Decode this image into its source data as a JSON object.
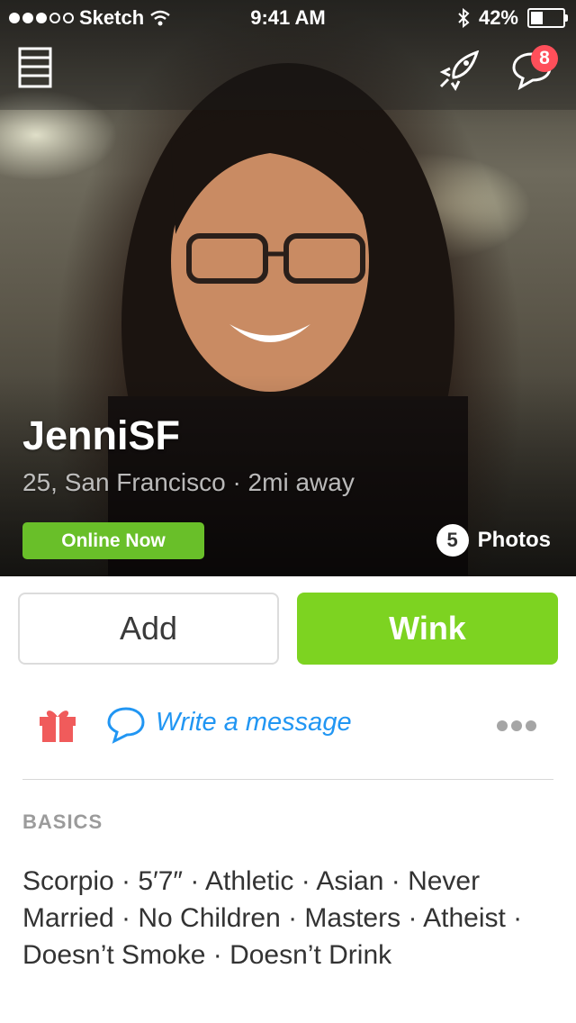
{
  "status_bar": {
    "carrier": "Sketch",
    "time": "9:41 AM",
    "battery_percent": "42%",
    "battery_level": 0.42
  },
  "nav": {
    "menu_icon": "menu-icon",
    "boost_icon": "rocket-icon",
    "messages_icon": "chat-bubble-icon",
    "messages_badge": "8"
  },
  "profile": {
    "name": "JenniSF",
    "subline": "25, San Francisco · 2mi away",
    "status": "Online Now",
    "photo_count": "5",
    "photos_label": "Photos"
  },
  "actions": {
    "add_label": "Add",
    "wink_label": "Wink",
    "write_message": "Write a message"
  },
  "basics": {
    "title": "BASICS",
    "text": "Scorpio · 5′7″ · Athletic · Asian · Never Married · No Children · Masters · Atheist · Doesn’t Smoke · Doesn’t Drink"
  },
  "colors": {
    "accent_green": "#7dd321",
    "online_green": "#69bf29",
    "link_blue": "#2196f3",
    "badge_red": "#ff4f5a",
    "gift_red": "#f05b5b"
  }
}
